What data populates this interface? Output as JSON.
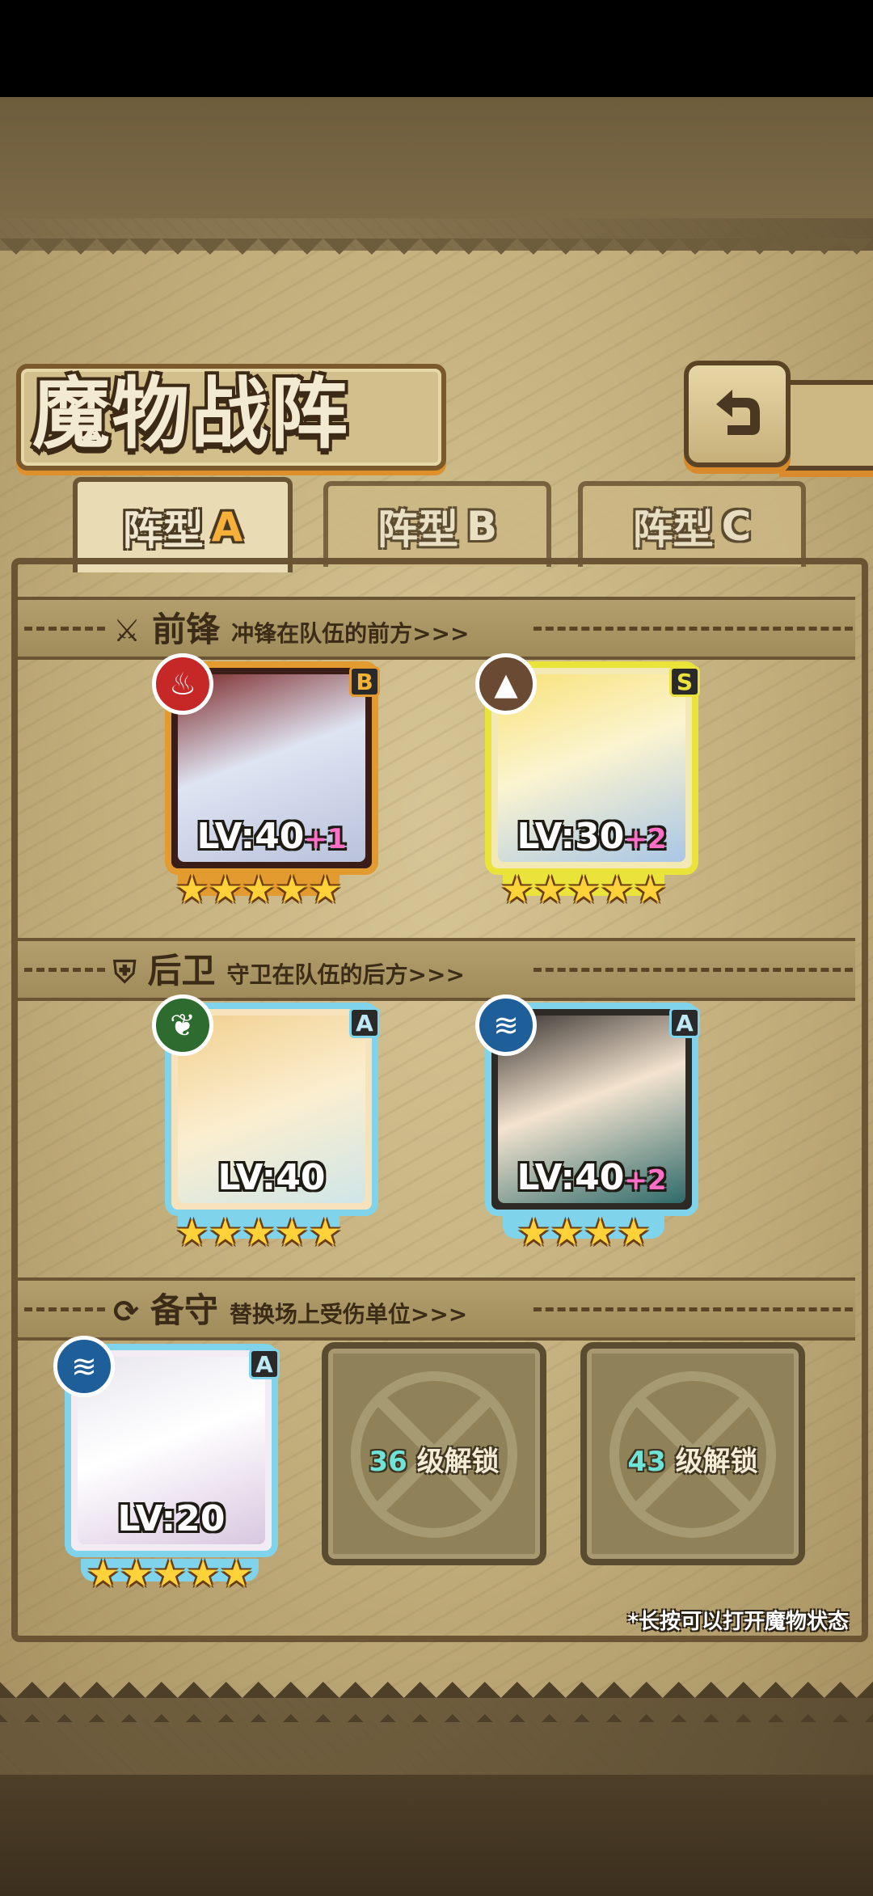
{
  "title": "魔物战阵",
  "tabs": [
    {
      "label": "阵型",
      "letter": "A",
      "active": true
    },
    {
      "label": "阵型",
      "letter": "B",
      "active": false
    },
    {
      "label": "阵型",
      "letter": "C",
      "active": false
    }
  ],
  "sections": {
    "front": {
      "title": "前锋",
      "desc": "冲锋在队伍的前方>>>"
    },
    "back": {
      "title": "后卫",
      "desc": "守卫在队伍的后方>>>"
    },
    "reserve": {
      "title": "备守",
      "desc": "替换场上受伤单位>>>"
    }
  },
  "cards": [
    {
      "grade": "B",
      "level": "LV:40",
      "plus": "+1",
      "stars": "★★★★★",
      "element": "fire-icon",
      "frame": "#e39a2e",
      "elemColor": "#c62828"
    },
    {
      "grade": "S",
      "level": "LV:30",
      "plus": "+2",
      "stars": "★★★★★",
      "element": "earth-icon",
      "frame": "#e9e33a",
      "elemColor": "#6b4a33"
    },
    {
      "grade": "A",
      "level": "LV:40",
      "plus": "",
      "stars": "★★★★★",
      "element": "leaf-icon",
      "frame": "#7fd4ec",
      "elemColor": "#2e6b2f"
    },
    {
      "grade": "A",
      "level": "LV:40",
      "plus": "+2",
      "stars": "★★★★",
      "element": "water-icon",
      "frame": "#7fd4ec",
      "elemColor": "#1e5f9a"
    },
    {
      "grade": "A",
      "level": "LV:20",
      "plus": "",
      "stars": "★★★★★",
      "element": "water-icon",
      "frame": "#7fd4ec",
      "elemColor": "#1e5f9a"
    }
  ],
  "locked": [
    {
      "num": "36",
      "text": "级解锁"
    },
    {
      "num": "43",
      "text": "级解锁"
    }
  ],
  "hint": "*长按可以打开魔物状态"
}
